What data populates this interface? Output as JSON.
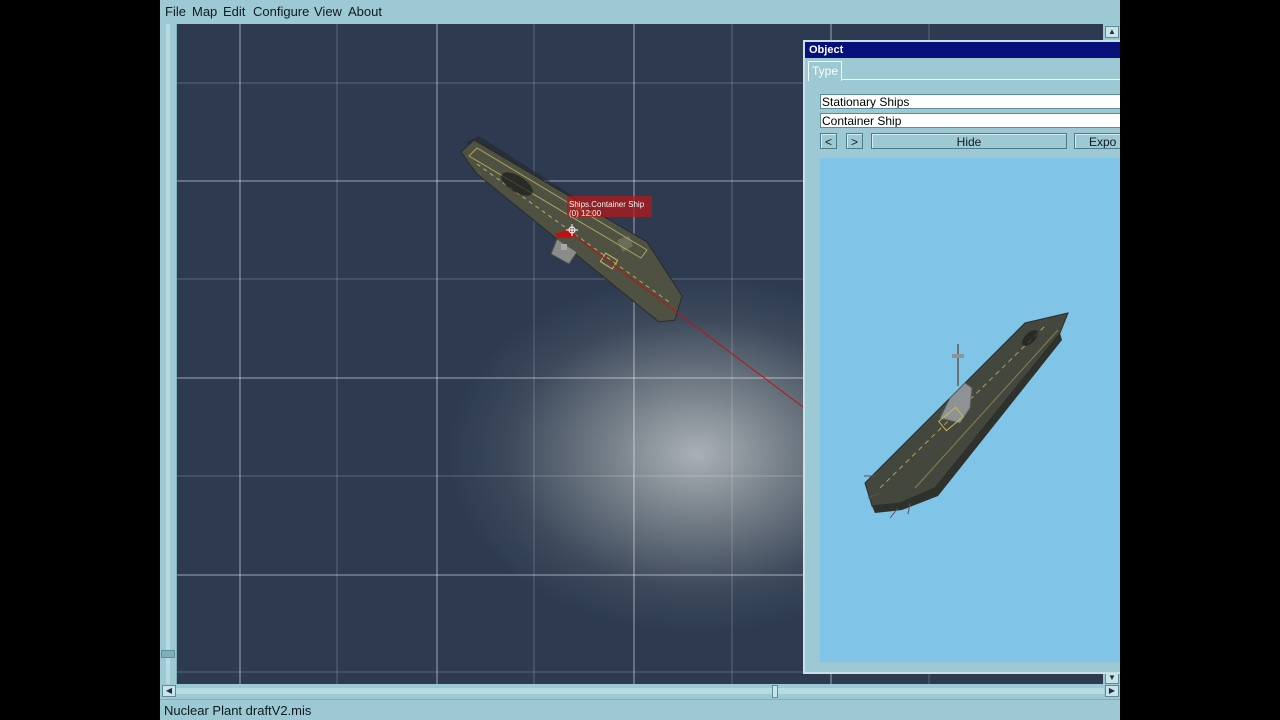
{
  "menu": {
    "file": "File",
    "map": "Map",
    "edit": "Edit",
    "configure": "Configure",
    "view": "View",
    "about": "About"
  },
  "map_view": {
    "object_label_line1": "Ships.Container Ship",
    "object_label_line2": "(0) 12:00",
    "selection_color": "#cc1010"
  },
  "object_panel": {
    "title": "Object",
    "tab_type": "Type",
    "category_value": "Stationary Ships",
    "object_value": "Container Ship",
    "prev_button": "<",
    "next_button": ">",
    "hide_button": "Hide",
    "export_button": "Expo",
    "preview_bg_color": "#80c4e8",
    "title_bar_color": "#07107a"
  },
  "status": {
    "filename": "Nuclear Plant draftV2.mis"
  },
  "colors": {
    "ui_background": "#9cc9d3"
  }
}
